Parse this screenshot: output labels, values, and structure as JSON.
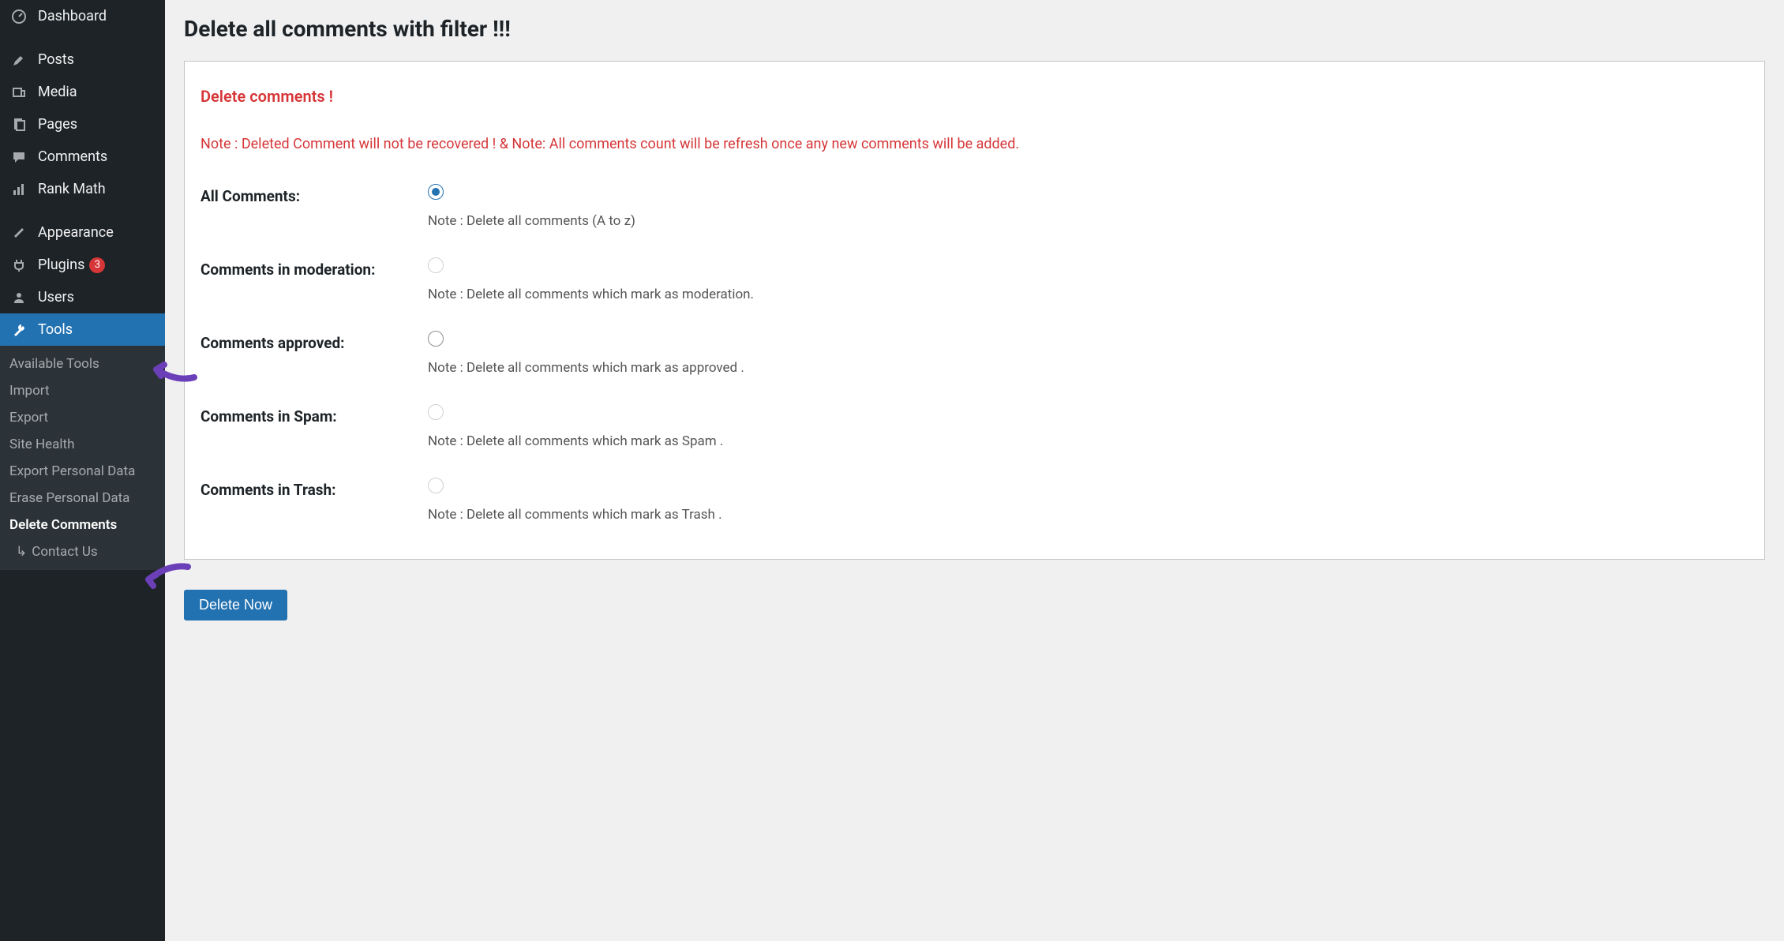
{
  "sidebar": {
    "items": [
      {
        "id": "dashboard",
        "label": "Dashboard",
        "icon": "dash"
      },
      {
        "id": "posts",
        "label": "Posts",
        "icon": "pin"
      },
      {
        "id": "media",
        "label": "Media",
        "icon": "media"
      },
      {
        "id": "pages",
        "label": "Pages",
        "icon": "page"
      },
      {
        "id": "comments",
        "label": "Comments",
        "icon": "comment"
      },
      {
        "id": "rankmath",
        "label": "Rank Math",
        "icon": "chart"
      },
      {
        "id": "appearance",
        "label": "Appearance",
        "icon": "brush"
      },
      {
        "id": "plugins",
        "label": "Plugins",
        "icon": "plug",
        "badge": "3"
      },
      {
        "id": "users",
        "label": "Users",
        "icon": "user"
      },
      {
        "id": "tools",
        "label": "Tools",
        "icon": "wrench",
        "active": true
      }
    ],
    "submenu": [
      {
        "label": "Available Tools"
      },
      {
        "label": "Import"
      },
      {
        "label": "Export"
      },
      {
        "label": "Site Health"
      },
      {
        "label": "Export Personal Data"
      },
      {
        "label": "Erase Personal Data"
      },
      {
        "label": "Delete Comments",
        "current": true
      },
      {
        "label": "Contact Us",
        "nested": true
      }
    ]
  },
  "page": {
    "title": "Delete all comments with filter !!!",
    "warn_title": "Delete comments !",
    "warn_note": "Note : Deleted Comment will not be recovered ! & Note: All comments count will be refresh once any new comments will be added.",
    "options": [
      {
        "label": "All Comments:",
        "note": "Note : Delete all comments (A to z)",
        "checked": true
      },
      {
        "label": "Comments in moderation:",
        "note": "Note : Delete all comments which mark as moderation.",
        "dim": true
      },
      {
        "label": "Comments approved:",
        "note": "Note : Delete all comments which mark as approved ."
      },
      {
        "label": "Comments in Spam:",
        "note": "Note : Delete all comments which mark as Spam .",
        "dim": true
      },
      {
        "label": "Comments in Trash:",
        "note": "Note : Delete all comments which mark as Trash .",
        "dim": true
      }
    ],
    "submit_label": "Delete Now"
  }
}
